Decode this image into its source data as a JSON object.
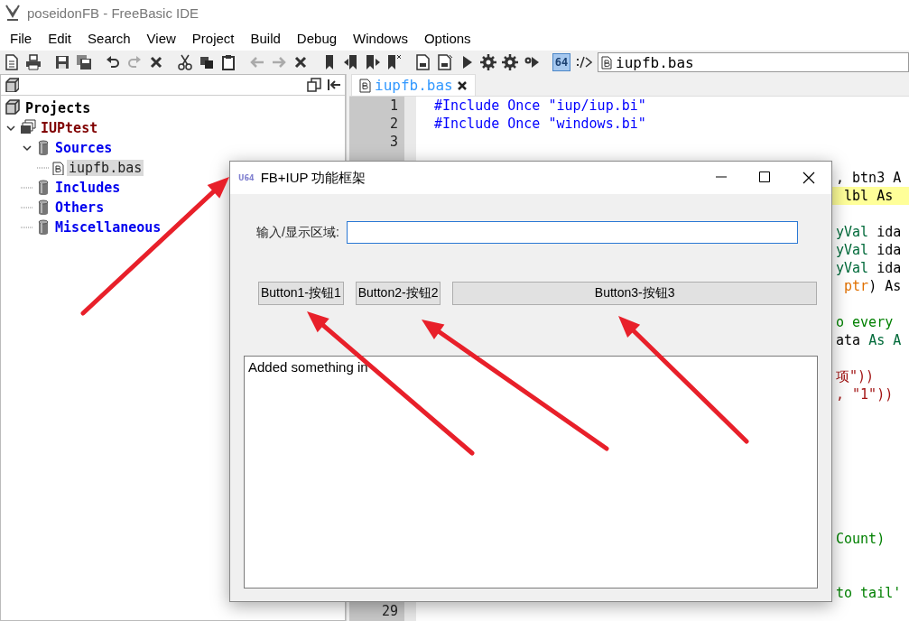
{
  "window": {
    "title": "poseidonFB - FreeBasic IDE"
  },
  "menu": [
    "File",
    "Edit",
    "Search",
    "View",
    "Project",
    "Build",
    "Debug",
    "Windows",
    "Options"
  ],
  "toolbar": {
    "toggle": {
      "label": "64",
      "selected": true
    },
    "file_field": {
      "value": "iupfb.bas"
    }
  },
  "project_tree": [
    {
      "label": "Projects",
      "kind": "root",
      "children": [
        {
          "label": "IUPtest",
          "kind": "project",
          "expanded": true,
          "children": [
            {
              "label": "Sources",
              "kind": "folder",
              "expanded": true,
              "children": [
                {
                  "label": "iupfb.bas",
                  "kind": "file",
                  "selected": true
                }
              ]
            },
            {
              "label": "Includes",
              "kind": "folder"
            },
            {
              "label": "Others",
              "kind": "folder"
            },
            {
              "label": "Miscellaneous",
              "kind": "folder"
            }
          ]
        }
      ]
    }
  ],
  "editor": {
    "tabs": [
      {
        "label": "iupfb.bas",
        "selected": true
      }
    ],
    "lines": [
      {
        "number": "1",
        "highlighted": false,
        "segments": [
          {
            "text": "#Include Once ",
            "kind": "directive"
          },
          {
            "text": "\"iup/iup.bi\"",
            "kind": "directive"
          }
        ]
      },
      {
        "number": "2",
        "highlighted": false,
        "segments": [
          {
            "text": "#Include Once ",
            "kind": "directive"
          },
          {
            "text": "\"windows.bi\"",
            "kind": "directive"
          }
        ]
      },
      {
        "number": "3",
        "highlighted": false
      },
      {
        "highlighted": false
      },
      {
        "highlighted": false,
        "segments": [
          {
            "text": ", btn3 A",
            "kind": "plain"
          }
        ]
      },
      {
        "highlighted": true,
        "segments": [
          {
            "text": " lbl As",
            "kind": "plain"
          }
        ]
      },
      {
        "highlighted": false
      },
      {
        "highlighted": false,
        "segments": [
          {
            "text": "yVal",
            "kind": "keyword"
          },
          {
            "text": " ida",
            "kind": "plain"
          }
        ]
      },
      {
        "highlighted": false,
        "segments": [
          {
            "text": "yVal",
            "kind": "keyword"
          },
          {
            "text": " ida",
            "kind": "plain"
          }
        ]
      },
      {
        "highlighted": false,
        "segments": [
          {
            "text": "yVal",
            "kind": "keyword"
          },
          {
            "text": " ida",
            "kind": "plain"
          }
        ]
      },
      {
        "highlighted": false,
        "segments": [
          {
            "text": " ptr",
            "kind": "type"
          },
          {
            "text": ") As",
            "kind": "plain"
          }
        ]
      },
      {
        "highlighted": false
      },
      {
        "highlighted": false,
        "segments": [
          {
            "text": "o every",
            "kind": "comment"
          }
        ]
      },
      {
        "highlighted": false,
        "segments": [
          {
            "text": "ata ",
            "kind": "plain"
          },
          {
            "text": "As A",
            "kind": "keyword"
          }
        ]
      },
      {
        "highlighted": false
      },
      {
        "highlighted": false,
        "segments": [
          {
            "text": "项\"))",
            "kind": "string"
          }
        ]
      },
      {
        "highlighted": false,
        "segments": [
          {
            "text": ", \"1\"))",
            "kind": "string"
          }
        ]
      },
      {
        "highlighted": false
      },
      {
        "highlighted": false
      },
      {
        "highlighted": false
      },
      {
        "highlighted": false
      },
      {
        "highlighted": false
      },
      {
        "highlighted": false
      },
      {
        "highlighted": false
      },
      {
        "highlighted": false,
        "segments": [
          {
            "text": "Count)",
            "kind": "comment"
          }
        ]
      },
      {
        "highlighted": false
      },
      {
        "highlighted": false
      },
      {
        "highlighted": false,
        "segments": [
          {
            "text": "to tail'",
            "kind": "comment"
          }
        ]
      },
      {
        "number": "29",
        "highlighted": false
      }
    ]
  },
  "dialog": {
    "badge": "U64",
    "title": "FB+IUP 功能框架",
    "field_label": "输入/显示区域:",
    "buttons": [
      "Button1-按钮1",
      "Button2-按钮2",
      "Button3-按钮3"
    ],
    "output": "Added something in"
  }
}
